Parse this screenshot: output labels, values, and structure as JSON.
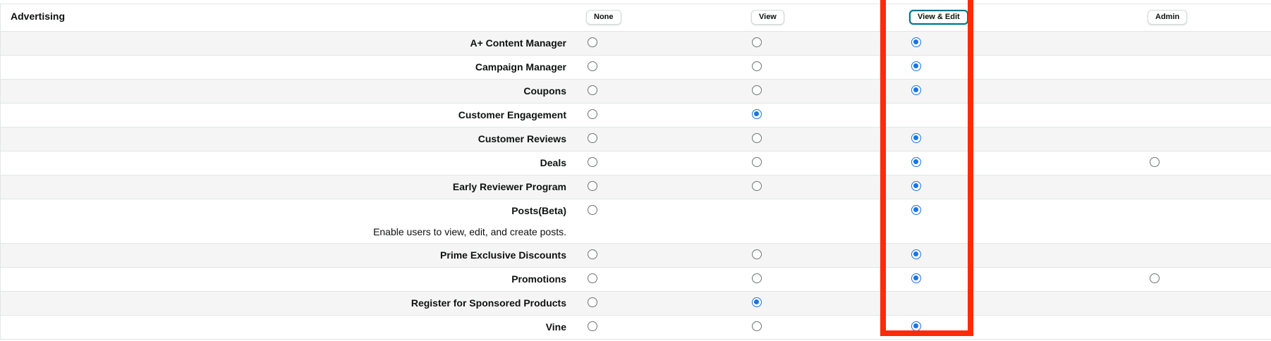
{
  "section_title": "Advertising",
  "columns": [
    "None",
    "View",
    "View & Edit",
    "Admin"
  ],
  "column_keys": [
    "none",
    "view",
    "edit",
    "admin"
  ],
  "rows": [
    {
      "label": "A+ Content Manager",
      "options": [
        "none",
        "view",
        "edit"
      ],
      "selected": "edit"
    },
    {
      "label": "Campaign Manager",
      "options": [
        "none",
        "view",
        "edit"
      ],
      "selected": "edit"
    },
    {
      "label": "Coupons",
      "options": [
        "none",
        "view",
        "edit"
      ],
      "selected": "edit"
    },
    {
      "label": "Customer Engagement",
      "options": [
        "none",
        "view"
      ],
      "selected": "view"
    },
    {
      "label": "Customer Reviews",
      "options": [
        "none",
        "view",
        "edit"
      ],
      "selected": "edit"
    },
    {
      "label": "Deals",
      "options": [
        "none",
        "view",
        "edit",
        "admin"
      ],
      "selected": "edit"
    },
    {
      "label": "Early Reviewer Program",
      "options": [
        "none",
        "view",
        "edit"
      ],
      "selected": "edit"
    },
    {
      "label": "Posts(Beta)",
      "description": "Enable users to view, edit, and create posts.",
      "options": [
        "none",
        "edit"
      ],
      "selected": "edit"
    },
    {
      "label": "Prime Exclusive Discounts",
      "options": [
        "none",
        "view",
        "edit"
      ],
      "selected": "edit"
    },
    {
      "label": "Promotions",
      "options": [
        "none",
        "view",
        "edit",
        "admin"
      ],
      "selected": "edit"
    },
    {
      "label": "Register for Sponsored Products",
      "options": [
        "none",
        "view"
      ],
      "selected": "view"
    },
    {
      "label": "Vine",
      "options": [
        "none",
        "view",
        "edit"
      ],
      "selected": "edit"
    }
  ],
  "highlight_color": "#ff2a0a",
  "radio_checked_color": "#1a73e8"
}
